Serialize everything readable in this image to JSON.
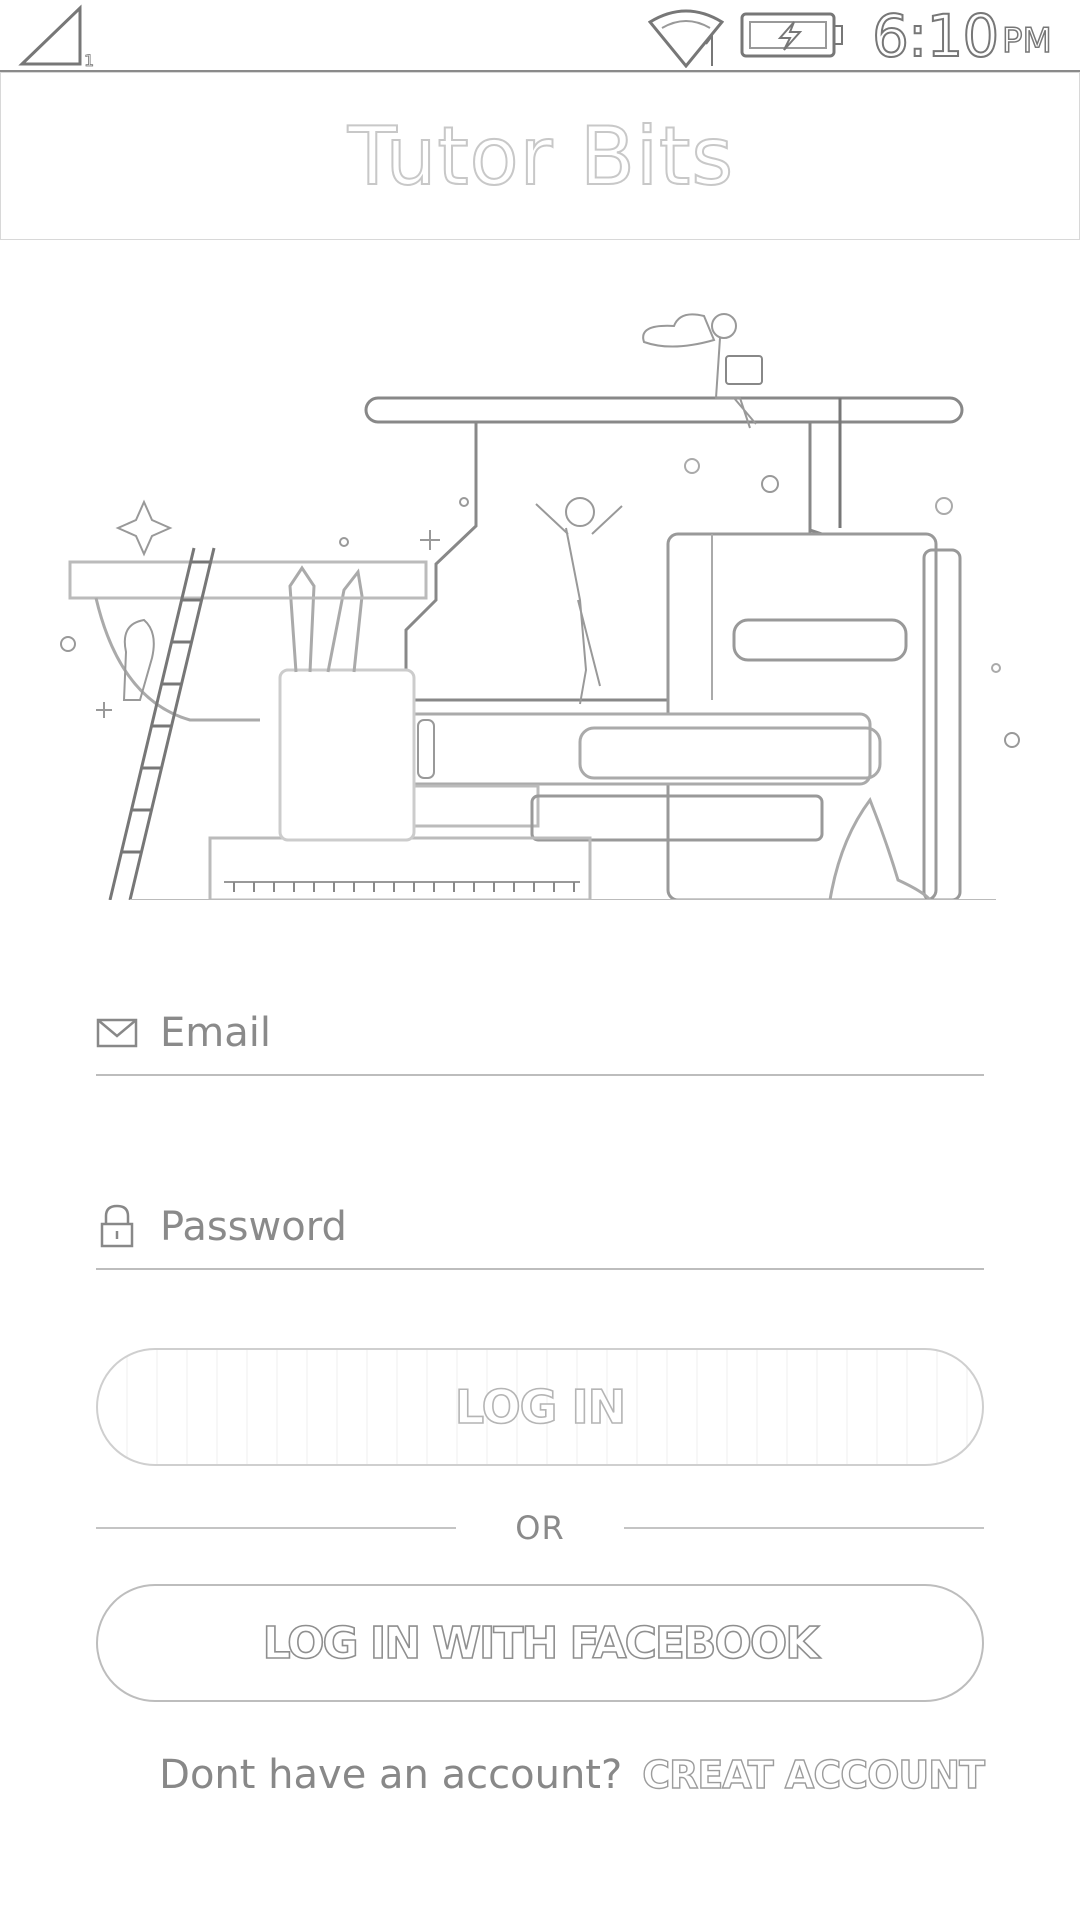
{
  "status_bar": {
    "sim_slot": "1",
    "time": "6:10",
    "ampm": "PM",
    "icons": [
      "signal-icon",
      "wifi-icon",
      "battery-charging-icon"
    ]
  },
  "app_bar": {
    "title": "Tutor Bits"
  },
  "illustration": {
    "icon": "education-illustration"
  },
  "form": {
    "email": {
      "placeholder": "Email",
      "value": "",
      "icon": "mail-icon"
    },
    "password": {
      "placeholder": "Password",
      "value": "",
      "icon": "lock-icon"
    },
    "login_label": "LOG IN",
    "or_label": "OR",
    "facebook_label": "LOG IN WITH FACEBOOK",
    "signup_prompt": "Dont have an account?",
    "signup_link": "CREAT ACCOUNT"
  },
  "colors": {
    "background": "#ffffff",
    "outline": "#8a8a8a",
    "divider": "#bdbdbd"
  }
}
